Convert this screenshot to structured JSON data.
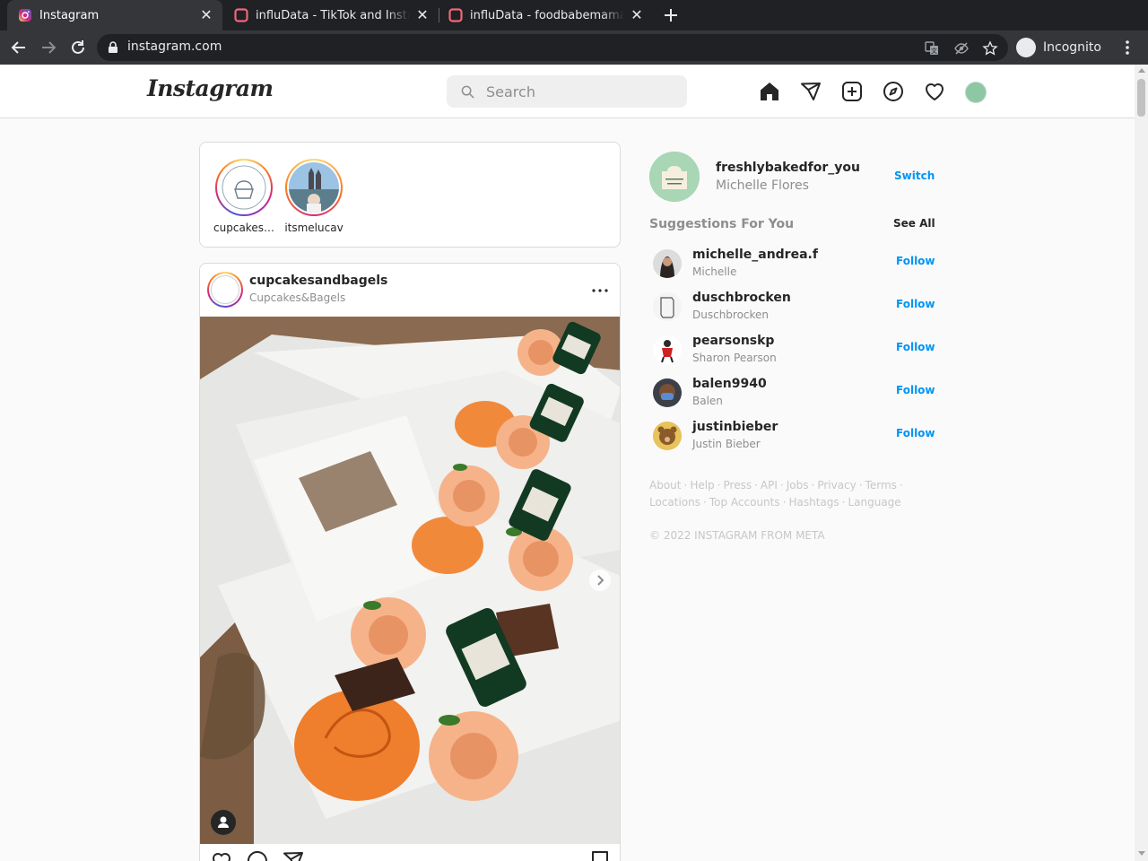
{
  "browser": {
    "tabs": [
      {
        "title": "Instagram",
        "active": true
      },
      {
        "title": "influData - TikTok and Instagram",
        "active": false
      },
      {
        "title": "influData - foodbabemama",
        "active": false
      }
    ],
    "url": "instagram.com",
    "profile_label": "Incognito"
  },
  "header": {
    "logo": "Instagram",
    "search_placeholder": "Search"
  },
  "stories": [
    {
      "name": "cupcakes…"
    },
    {
      "name": "itsmelucav"
    }
  ],
  "post": {
    "username": "cupcakesandbagels",
    "subtitle": "Cupcakes&Bagels",
    "more_label": "..."
  },
  "sidebar": {
    "username": "freshlybakedfor_you",
    "full_name": "Michelle Flores",
    "switch_label": "Switch",
    "suggestions_title": "Suggestions For You",
    "see_all_label": "See All",
    "follow_label": "Follow",
    "suggestions": [
      {
        "username": "michelle_andrea.f",
        "name": "Michelle"
      },
      {
        "username": "duschbrocken",
        "name": "Duschbrocken"
      },
      {
        "username": "pearsonskp",
        "name": "Sharon Pearson"
      },
      {
        "username": "balen9940",
        "name": "Balen"
      },
      {
        "username": "justinbieber",
        "name": "Justin Bieber"
      }
    ],
    "footer_links": [
      "About",
      "Help",
      "Press",
      "API",
      "Jobs",
      "Privacy",
      "Terms",
      "Locations",
      "Top Accounts",
      "Hashtags",
      "Language"
    ],
    "copyright": "© 2022 INSTAGRAM FROM META"
  },
  "colors": {
    "link_blue": "#0095f6",
    "chrome_dark": "#202124",
    "chrome_toolbar": "#35363a"
  }
}
